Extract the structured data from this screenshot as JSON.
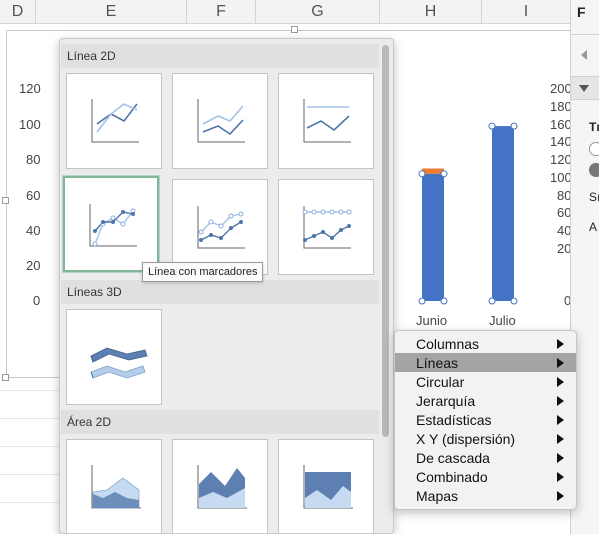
{
  "columns": [
    "D",
    "E",
    "F",
    "G",
    "H",
    "I"
  ],
  "chart": {
    "y_left_ticks": [
      "120",
      "100",
      "80",
      "60",
      "40",
      "20",
      "0"
    ],
    "y_right_ticks": [
      "200",
      "180",
      "160",
      "140",
      "120",
      "100",
      "80",
      "60",
      "40",
      "20",
      "0"
    ],
    "x_labels": [
      "Junio",
      "Julio"
    ],
    "bar_color": "#4472c4",
    "accent_color": "#ed7d31"
  },
  "chart_data": {
    "type": "bar",
    "categories": [
      "Junio",
      "Julio"
    ],
    "series": [
      {
        "values": [
          120,
          165
        ]
      },
      {
        "values": [
          5,
          0
        ]
      }
    ],
    "ylim": [
      0,
      200
    ]
  },
  "gallery": {
    "sections": [
      "Línea 2D",
      "Líneas 3D",
      "Área 2D"
    ],
    "tooltip": "Línea con marcadores"
  },
  "menu": {
    "items": [
      {
        "label": "Columnas"
      },
      {
        "label": "Líneas"
      },
      {
        "label": "Circular"
      },
      {
        "label": "Jerarquía"
      },
      {
        "label": "Estadísticas"
      },
      {
        "label": "X Y (dispersión)"
      },
      {
        "label": "De cascada"
      },
      {
        "label": "Combinado"
      },
      {
        "label": "Mapas"
      }
    ]
  },
  "side_pane": {
    "texts": [
      "F",
      "Tı",
      "Sı",
      "A"
    ]
  }
}
